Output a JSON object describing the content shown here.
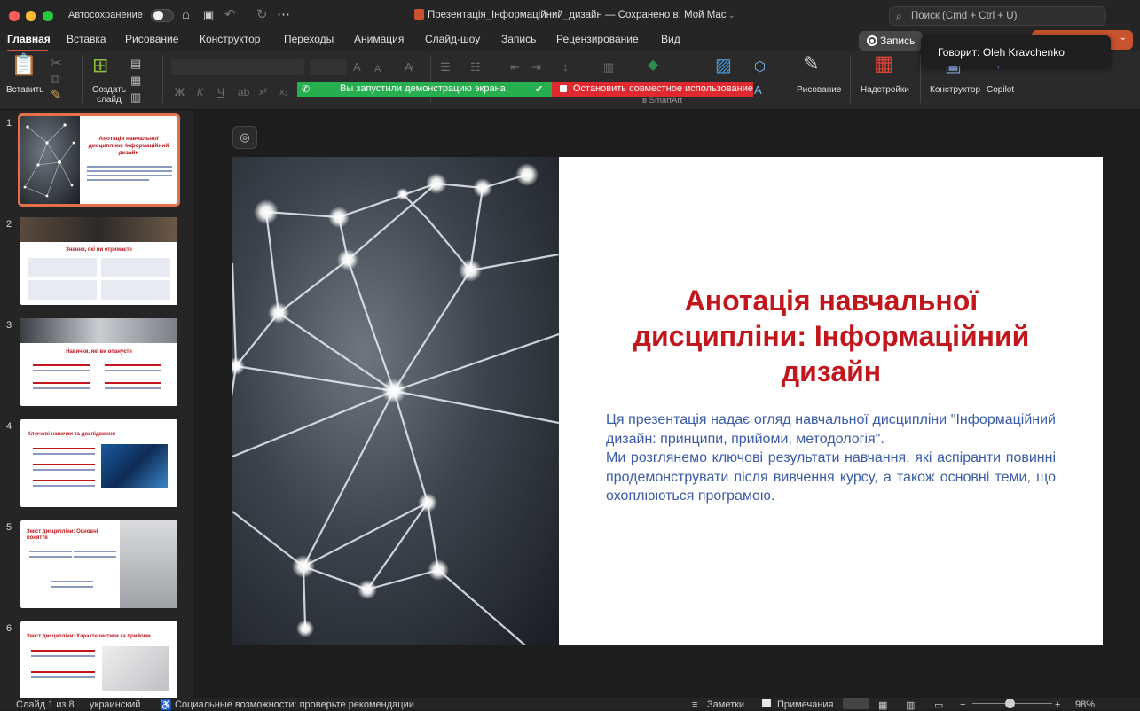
{
  "window": {
    "autosave_label": "Автосохранение",
    "doc_title": "Презентація_Інформаційний_дизайн — Сохранено в: Мой Mac",
    "search_placeholder": "Поиск (Cmd + Ctrl + U)"
  },
  "menu": {
    "items": [
      "Главная",
      "Вставка",
      "Рисование",
      "Конструктор",
      "Переходы",
      "Анимация",
      "Слайд-шоу",
      "Запись",
      "Рецензирование",
      "Вид"
    ],
    "record_button": "Запись"
  },
  "speaker_tooltip": "Говорит: Oleh Kravchenko",
  "ribbon": {
    "paste": "Вставить",
    "new_slide": "Создать слайд",
    "drawing": "Рисование",
    "addins": "Надстройки",
    "designer": "Конструктор",
    "copilot": "Copilot",
    "smartart": "в SmartArt"
  },
  "screen_share": {
    "status": "Вы запустили демонстрацию экрана",
    "stop": "Остановить совместное использование"
  },
  "slides": [
    {
      "number": "1"
    },
    {
      "number": "2",
      "title": "Знання, які ви отримаєте"
    },
    {
      "number": "3",
      "title": "Навички, які ви опануєте"
    },
    {
      "number": "4",
      "title": "Ключові навички та дослідження"
    },
    {
      "number": "5",
      "title": "Зміст дисципліни: Основні поняття"
    },
    {
      "number": "6",
      "title": "Зміст дисципліни: Характеристики та прийоми"
    }
  ],
  "current_slide": {
    "title": "Анотація навчальної дисципліни: Інформаційний дизайн",
    "paragraph1": "Ця презентація надає огляд навчальної дисципліни \"Інформаційний дизайн: принципи, прийоми, методологія\".",
    "paragraph2": "Ми розглянемо ключові результати навчання, які аспіранти повинні продемонструвати після вивчення курсу, а також основні теми, що охоплюються програмою."
  },
  "status": {
    "slide_of": "Слайд 1 из 8",
    "language": "украинский",
    "accessibility": "Социальные возможности: проверьте рекомендации",
    "notes": "Заметки",
    "comments": "Примечания",
    "zoom": "98%"
  }
}
